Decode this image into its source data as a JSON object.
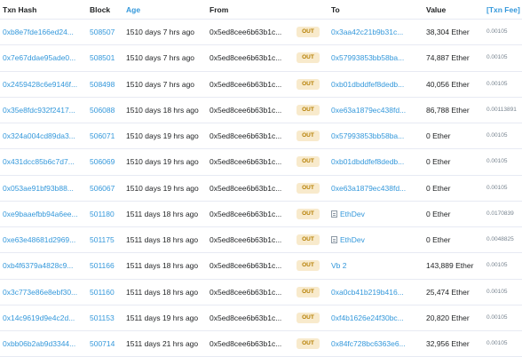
{
  "headers": {
    "txn_hash": "Txn Hash",
    "block": "Block",
    "age": "Age",
    "from": "From",
    "to": "To",
    "value": "Value",
    "txn_fee": "[Txn Fee]"
  },
  "rows": [
    {
      "hash": "0xb8e7fde166ed24...",
      "block": "508507",
      "age": "1510 days 7 hrs ago",
      "from": "0x5ed8cee6b63b1c...",
      "dir": "OUT",
      "to": "0x3aa42c21b9b31c...",
      "to_contract": false,
      "value": "38,304 Ether",
      "fee": "0.00105"
    },
    {
      "hash": "0x7e67ddae95ade0...",
      "block": "508501",
      "age": "1510 days 7 hrs ago",
      "from": "0x5ed8cee6b63b1c...",
      "dir": "OUT",
      "to": "0x57993853bb58ba...",
      "to_contract": false,
      "value": "74,887 Ether",
      "fee": "0.00105"
    },
    {
      "hash": "0x2459428c6e9146f...",
      "block": "508498",
      "age": "1510 days 7 hrs ago",
      "from": "0x5ed8cee6b63b1c...",
      "dir": "OUT",
      "to": "0xb01dbddfef8dedb...",
      "to_contract": false,
      "value": "40,056 Ether",
      "fee": "0.00105"
    },
    {
      "hash": "0x35e8fdc932f2417...",
      "block": "506088",
      "age": "1510 days 18 hrs ago",
      "from": "0x5ed8cee6b63b1c...",
      "dir": "OUT",
      "to": "0xe63a1879ec438fd...",
      "to_contract": false,
      "value": "86,788 Ether",
      "fee": "0.00113891"
    },
    {
      "hash": "0x324a004cd89da3...",
      "block": "506071",
      "age": "1510 days 19 hrs ago",
      "from": "0x5ed8cee6b63b1c...",
      "dir": "OUT",
      "to": "0x57993853bb58ba...",
      "to_contract": false,
      "value": "0 Ether",
      "fee": "0.00105"
    },
    {
      "hash": "0x431dcc85b6c7d7...",
      "block": "506069",
      "age": "1510 days 19 hrs ago",
      "from": "0x5ed8cee6b63b1c...",
      "dir": "OUT",
      "to": "0xb01dbddfef8dedb...",
      "to_contract": false,
      "value": "0 Ether",
      "fee": "0.00105"
    },
    {
      "hash": "0x053ae91bf93b88...",
      "block": "506067",
      "age": "1510 days 19 hrs ago",
      "from": "0x5ed8cee6b63b1c...",
      "dir": "OUT",
      "to": "0xe63a1879ec438fd...",
      "to_contract": false,
      "value": "0 Ether",
      "fee": "0.00105"
    },
    {
      "hash": "0xe9baaefbb94a6ee...",
      "block": "501180",
      "age": "1511 days 18 hrs ago",
      "from": "0x5ed8cee6b63b1c...",
      "dir": "OUT",
      "to": "EthDev",
      "to_contract": true,
      "value": "0 Ether",
      "fee": "0.0170839"
    },
    {
      "hash": "0xe63e48681d2969...",
      "block": "501175",
      "age": "1511 days 18 hrs ago",
      "from": "0x5ed8cee6b63b1c...",
      "dir": "OUT",
      "to": "EthDev",
      "to_contract": true,
      "value": "0 Ether",
      "fee": "0.0048825"
    },
    {
      "hash": "0xb4f6379a4828c9...",
      "block": "501166",
      "age": "1511 days 18 hrs ago",
      "from": "0x5ed8cee6b63b1c...",
      "dir": "OUT",
      "to": "Vb 2",
      "to_contract": false,
      "value": "143,889 Ether",
      "fee": "0.00105"
    },
    {
      "hash": "0x3c773e86e8ebf30...",
      "block": "501160",
      "age": "1511 days 18 hrs ago",
      "from": "0x5ed8cee6b63b1c...",
      "dir": "OUT",
      "to": "0xa0cb41b219b416...",
      "to_contract": false,
      "value": "25,474 Ether",
      "fee": "0.00105"
    },
    {
      "hash": "0x14c9619d9e4c2d...",
      "block": "501153",
      "age": "1511 days 19 hrs ago",
      "from": "0x5ed8cee6b63b1c...",
      "dir": "OUT",
      "to": "0xf4b1626e24f30bc...",
      "to_contract": false,
      "value": "20,820 Ether",
      "fee": "0.00105"
    },
    {
      "hash": "0xbb06b2ab9d3344...",
      "block": "500714",
      "age": "1511 days 21 hrs ago",
      "from": "0x5ed8cee6b63b1c...",
      "dir": "OUT",
      "to": "0x84fc728bc6363e6...",
      "to_contract": false,
      "value": "32,956 Ether",
      "fee": "0.00105"
    }
  ],
  "colors": {
    "link": "#3498db",
    "out_badge_bg": "#f8eacc",
    "out_badge_text": "#b47d00",
    "divider": "#e7eaf3"
  },
  "icons": {
    "contract": "contract-icon"
  }
}
